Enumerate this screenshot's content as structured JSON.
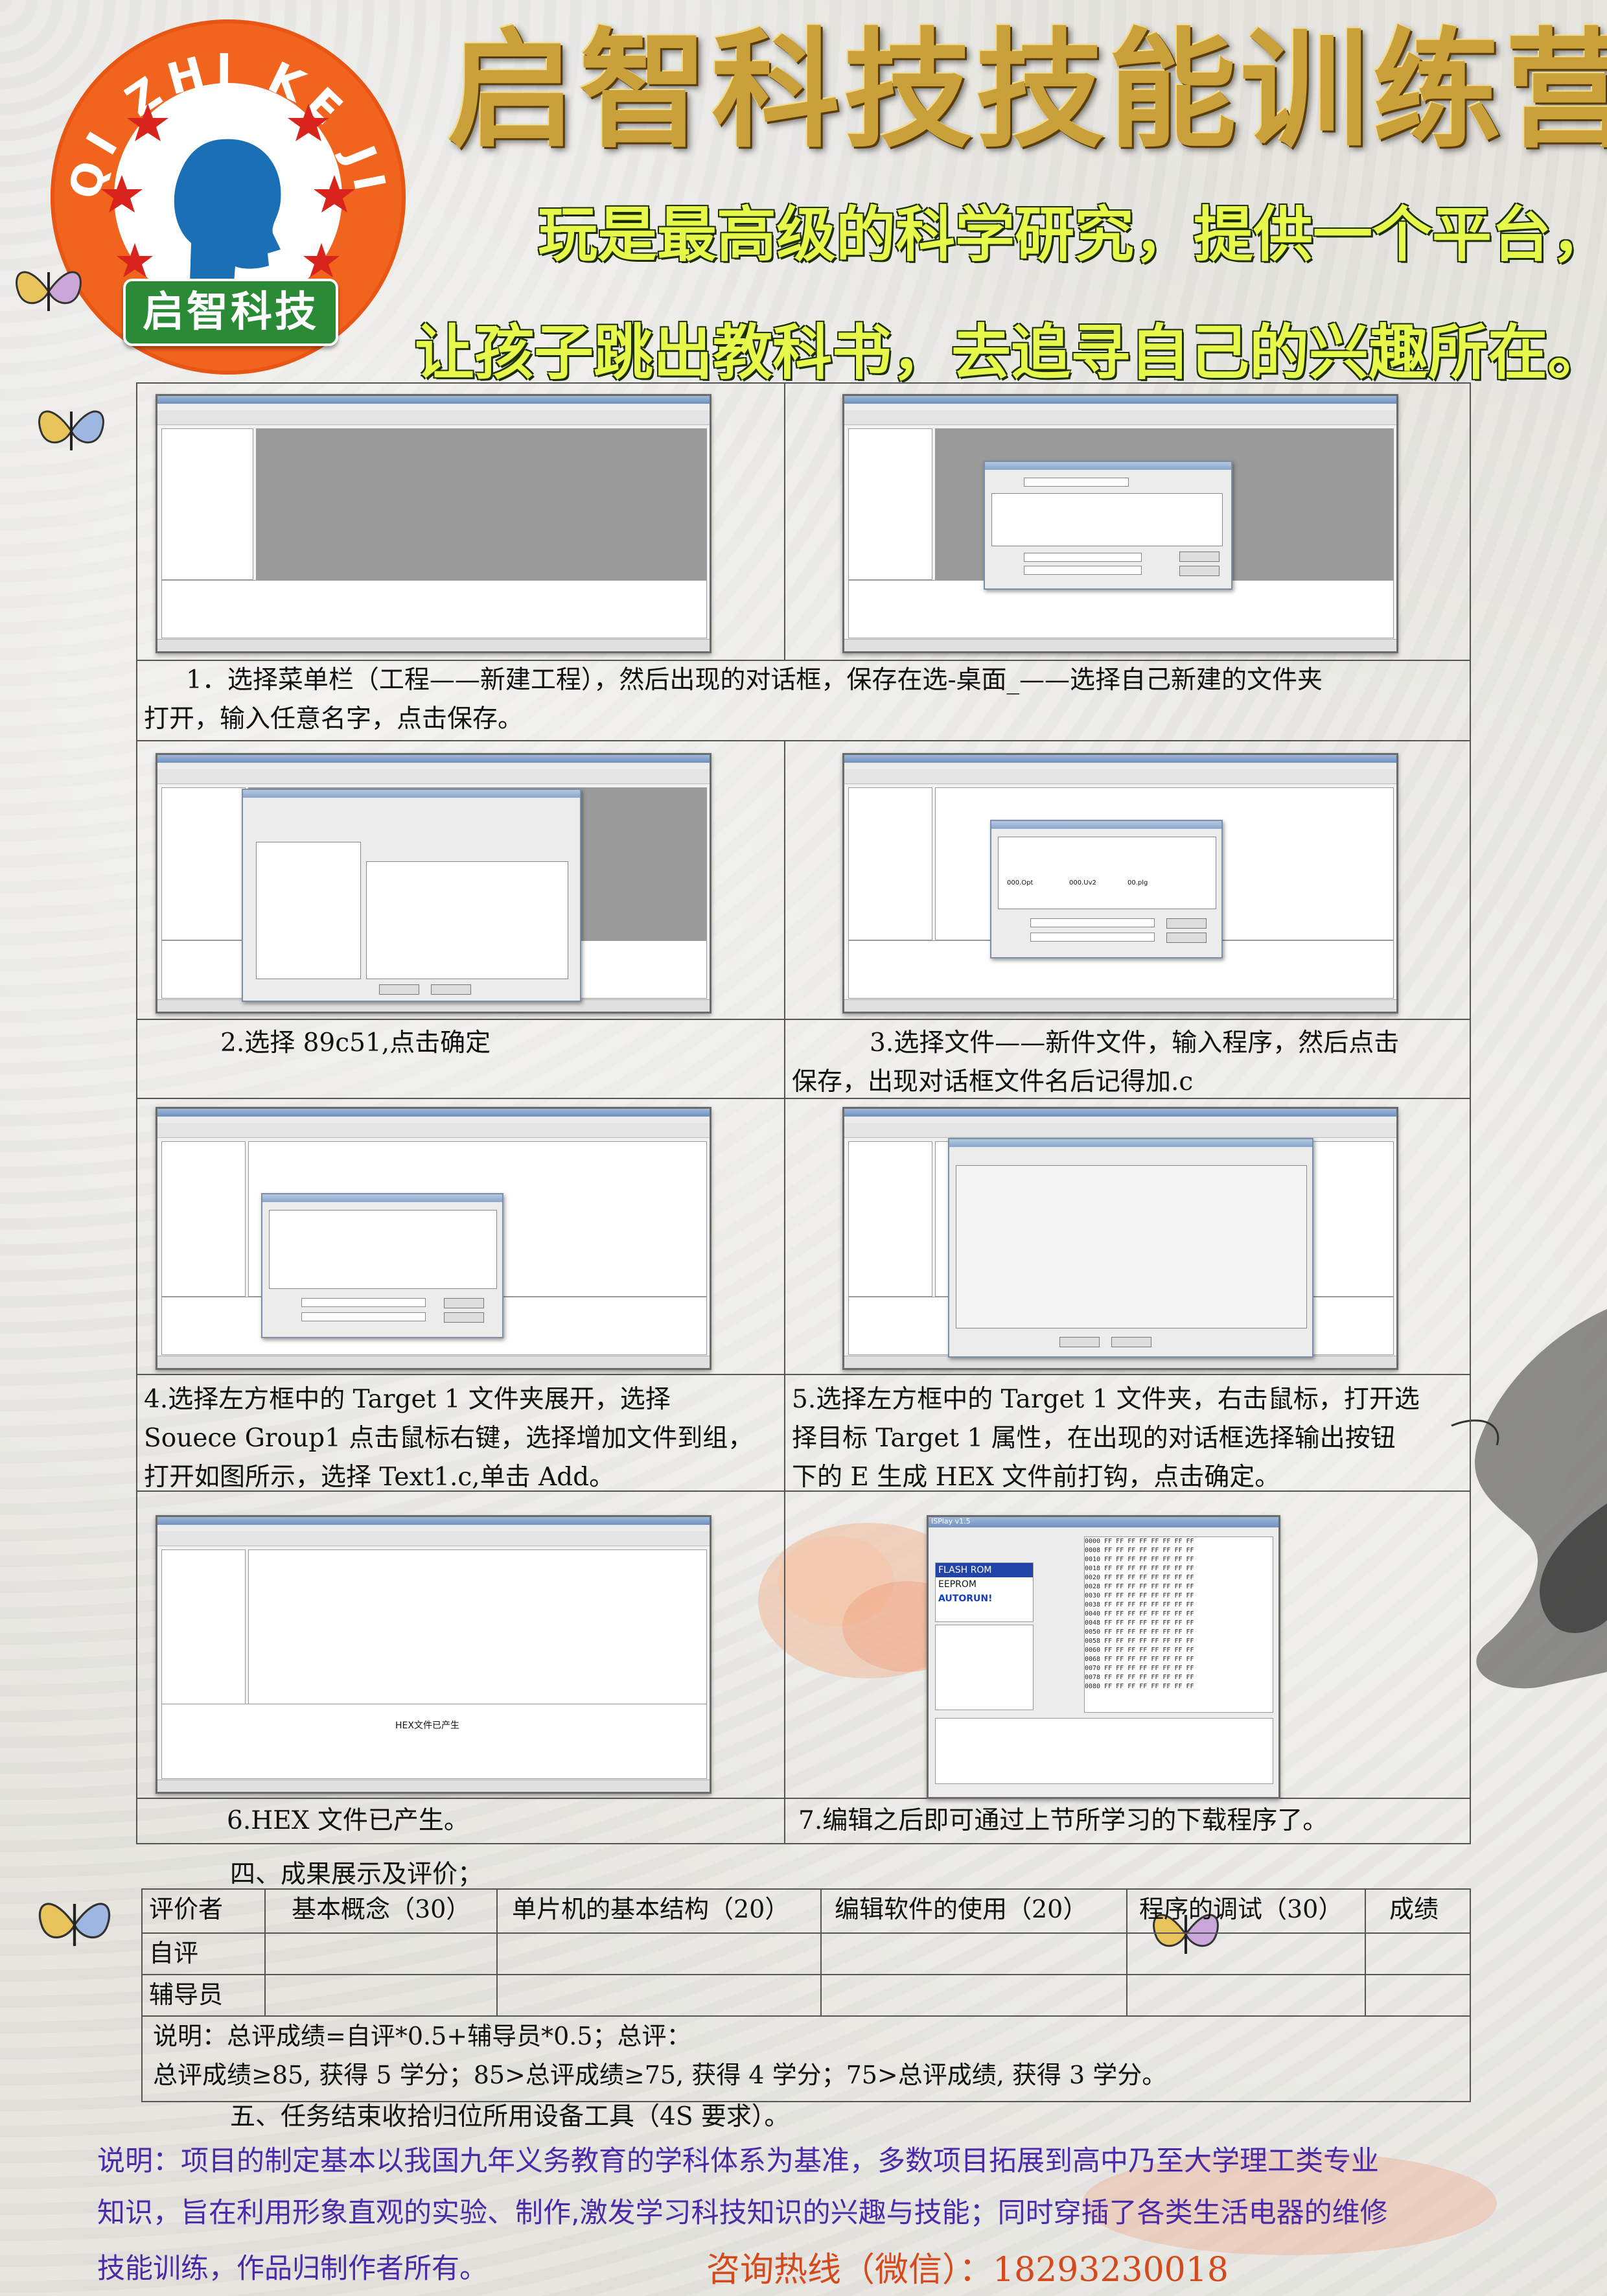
{
  "header": {
    "logo_ring_text": "QI ZHI KE JI",
    "logo_banner": "启智科技",
    "title": "启智科技技能训练营",
    "slogan_line1": "玩是最高级的科学研究，提供一个平台，",
    "slogan_line2": "让孩子跳出教科书，去追寻自己的兴趣所在。"
  },
  "steps": [
    {
      "text_line1": "1．选择菜单栏（工程——新建工程），然后出现的对话框，保存在选-桌面_——选择自己新建的文件夹",
      "text_line2": "打开，输入任意名字，点击保存。"
    },
    {
      "text": "2.选择 89c51,点击确定"
    },
    {
      "text_line1": "3.选择文件——新件文件，输入程序，然后点击",
      "text_line2": "保存，出现对话框文件名后记得加.c"
    },
    {
      "text_line1": "4.选择左方框中的 Target 1 文件夹展开，选择",
      "text_line2": "Souece Group1 点击鼠标右键，选择增加文件到组，",
      "text_line3": "打开如图所示，选择 Text1.c,单击 Add。"
    },
    {
      "text_line1": "5.选择左方框中的 Target 1 文件夹，右击鼠标，打开选",
      "text_line2": "择目标 Target 1 属性，在出现的对话框选择输出按钮",
      "text_line3": "下的 E 生成 HEX 文件前打钩，点击确定。"
    },
    {
      "text": "6.HEX 文件已产生。"
    },
    {
      "text": "7.编辑之后即可通过上节所学习的下载程序了。"
    }
  ],
  "screenshots": {
    "s3_dialog_files": [
      "000.Opt",
      "000.Uv2",
      "00.plg"
    ],
    "s6_output": "HEX文件已产生",
    "s7_title": "ISPlay v1.5",
    "s7_flash": "FLASH ROM",
    "s7_eeprom": "EEPROM",
    "s7_autorun": "AUTORUN!"
  },
  "section4": {
    "title": "四、成果展示及评价；",
    "headers": [
      "评价者",
      "基本概念（30）",
      "单片机的基本结构（20）",
      "编辑软件的使用（20）",
      "程序的调试（30）",
      "成绩"
    ],
    "rows": [
      [
        "自评",
        "",
        "",
        "",
        "",
        ""
      ],
      [
        "辅导员",
        "",
        "",
        "",
        "",
        ""
      ]
    ],
    "note_line1": "说明：总评成绩=自评*0.5+辅导员*0.5；总评：",
    "note_line2": "总评成绩≥85, 获得 5 学分；85>总评成绩≥75, 获得 4 学分；75>总评成绩, 获得 3 学分。"
  },
  "section5": {
    "title": "五、任务结束收拾归位所用设备工具（4S 要求）。"
  },
  "footer": {
    "line1": "说明：项目的制定基本以我国九年义务教育的学科体系为基准，多数项目拓展到高中乃至大学理工类专业",
    "line2": "知识，旨在利用形象直观的实验、制作,激发学习科技知识的兴趣与技能；同时穿插了各类生活电器的维修",
    "line3": "技能训练，作品归制作者所有。",
    "hotline": "咨询热线（微信）：18293230018"
  },
  "colors": {
    "title_gold": "#c9a03a",
    "slogan_yellow": "#e6f84a",
    "logo_orange": "#f0641e",
    "logo_green": "#2a8a36",
    "footer_purple": "#4b2aa8",
    "hotline_orange": "#d44a1c"
  }
}
